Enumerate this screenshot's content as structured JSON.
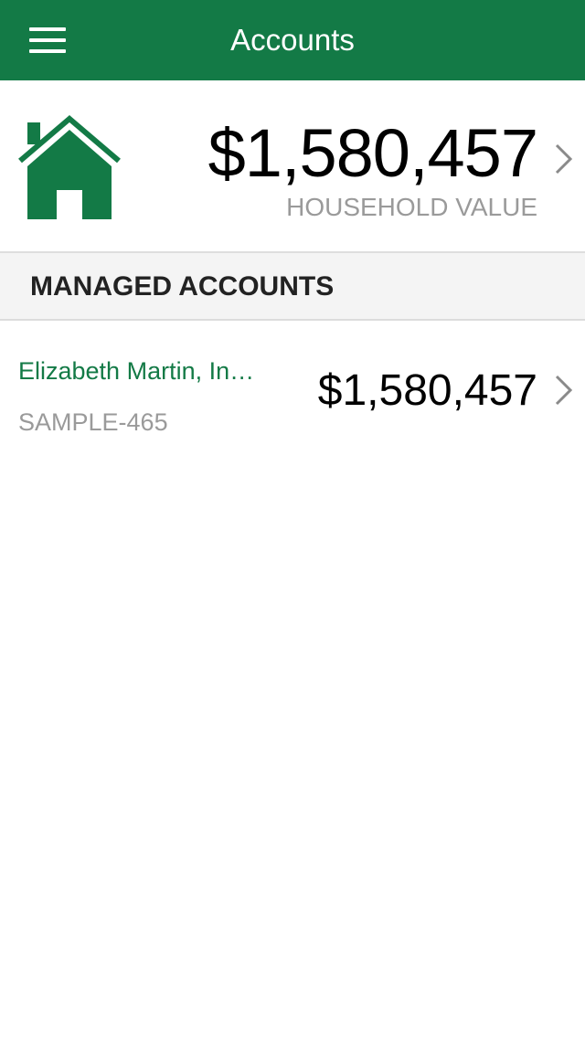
{
  "navbar": {
    "title": "Accounts",
    "menu_icon": "hamburger-menu-icon",
    "background": "#137a46"
  },
  "household": {
    "icon": "house-icon",
    "value": "$1,580,457",
    "label": "HOUSEHOLD VALUE"
  },
  "managed_accounts": {
    "header": "MANAGED ACCOUNTS",
    "items": [
      {
        "name": "Elizabeth Martin, In…",
        "account_id": "SAMPLE-465",
        "value": "$1,580,457"
      }
    ]
  },
  "colors": {
    "accent": "#137a46",
    "secondary_text": "#9a9a9a",
    "section_background": "#f4f4f4"
  }
}
